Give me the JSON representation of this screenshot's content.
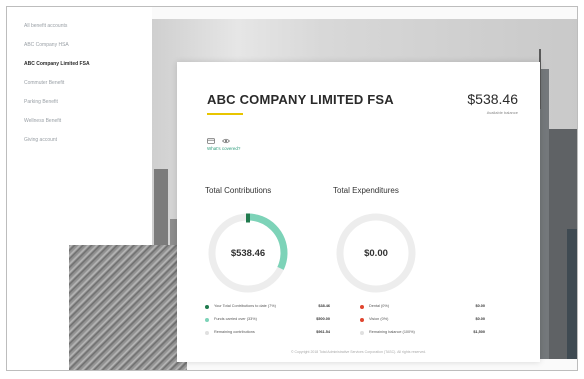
{
  "sidebar": {
    "items": [
      {
        "label": "All benefit accounts",
        "active": false
      },
      {
        "label": "ABC Company HSA",
        "active": false
      },
      {
        "label": "ABC Company Limited FSA",
        "active": true
      },
      {
        "label": "Commuter Benefit",
        "active": false
      },
      {
        "label": "Parking Benefit",
        "active": false
      },
      {
        "label": "Wellness Benefit",
        "active": false
      },
      {
        "label": "Giving account",
        "active": false
      }
    ]
  },
  "card": {
    "title": "ABC COMPANY LIMITED FSA",
    "balance": "$538.46",
    "balance_label": "Available balance",
    "covered_link": "What's covered?"
  },
  "contributions": {
    "title": "Total Contributions",
    "center_value": "$538.46",
    "progress_fraction": 0.32,
    "progress_color": "#7dd3b8",
    "track_color": "#ededed",
    "legend": [
      {
        "label": "Your Total Contributions to date (7%)",
        "value": "$38.46",
        "color": "#1f7a4d"
      },
      {
        "label": "Funds carried over (33%)",
        "value": "$500.00",
        "color": "#7dd3b8"
      },
      {
        "label": "Remaining contributions",
        "value": "$961.54",
        "color": "#e0e0e0"
      }
    ]
  },
  "expenditures": {
    "title": "Total Expenditures",
    "center_value": "$0.00",
    "progress_fraction": 0,
    "track_color": "#ededed",
    "legend": [
      {
        "label": "Dental (0%)",
        "value": "$0.00",
        "color": "#e0452f"
      },
      {
        "label": "Vision (0%)",
        "value": "$0.00",
        "color": "#e0452f"
      },
      {
        "label": "Remaining balance (100%)",
        "value": "$1,500",
        "color": "#e0e0e0"
      }
    ]
  },
  "footer": "© Copyright 2018 Total Administrative Services Corporation (TASC). All rights reserved."
}
